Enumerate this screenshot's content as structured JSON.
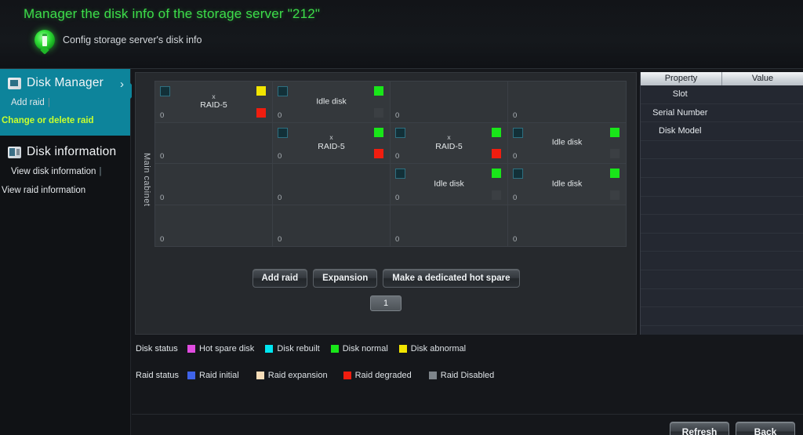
{
  "header": {
    "title": "Manager the disk info of the storage server \"212\"",
    "subtitle": "Config storage server's disk info",
    "icon": "disk-info-badge-icon"
  },
  "sidebar": {
    "groups": [
      {
        "title": "Disk Manager",
        "icon": "disk-manager-icon",
        "chevron": "›",
        "active": true,
        "links": [
          {
            "label": "Add raid",
            "highlight": false
          },
          {
            "label": "Change or delete raid",
            "highlight": true
          }
        ],
        "separator": "|"
      },
      {
        "title": "Disk information",
        "icon": "disk-information-icon",
        "active": false,
        "links": [
          {
            "label": "View disk information",
            "highlight": false
          },
          {
            "label": "View raid information",
            "highlight": false
          }
        ],
        "separator": "|"
      }
    ]
  },
  "main": {
    "cabinet_label": "Main cabinet",
    "grid": {
      "columns": 4,
      "rows": 4,
      "cells": [
        {
          "slot": "0",
          "label": "RAID-5",
          "prefix": "x",
          "status_top": "#f2e500",
          "status_bottom": "#f01d0f",
          "occupied": true
        },
        {
          "slot": "0",
          "label": "Idle disk",
          "prefix": "",
          "status_top": "#19e619",
          "status_bottom": "#3b3f43",
          "occupied": true
        },
        {
          "slot": "0",
          "label": "",
          "prefix": "",
          "status_top": "",
          "status_bottom": "",
          "occupied": false
        },
        {
          "slot": "0",
          "label": "",
          "prefix": "",
          "status_top": "",
          "status_bottom": "",
          "occupied": false
        },
        {
          "slot": "0",
          "label": "",
          "prefix": "",
          "status_top": "",
          "status_bottom": "",
          "occupied": false
        },
        {
          "slot": "0",
          "label": "RAID-5",
          "prefix": "x",
          "status_top": "#19e619",
          "status_bottom": "#f01d0f",
          "occupied": true
        },
        {
          "slot": "0",
          "label": "RAID-5",
          "prefix": "x",
          "status_top": "#19e619",
          "status_bottom": "#f01d0f",
          "occupied": true
        },
        {
          "slot": "0",
          "label": "Idle disk",
          "prefix": "",
          "status_top": "#19e619",
          "status_bottom": "#3b3f43",
          "occupied": true
        },
        {
          "slot": "0",
          "label": "",
          "prefix": "",
          "status_top": "",
          "status_bottom": "",
          "occupied": false
        },
        {
          "slot": "0",
          "label": "",
          "prefix": "",
          "status_top": "",
          "status_bottom": "",
          "occupied": false
        },
        {
          "slot": "0",
          "label": "Idle disk",
          "prefix": "",
          "status_top": "#19e619",
          "status_bottom": "#3b3f43",
          "occupied": true
        },
        {
          "slot": "0",
          "label": "Idle disk",
          "prefix": "",
          "status_top": "#19e619",
          "status_bottom": "#3b3f43",
          "occupied": true
        },
        {
          "slot": "0",
          "label": "",
          "prefix": "",
          "status_top": "",
          "status_bottom": "",
          "occupied": false
        },
        {
          "slot": "0",
          "label": "",
          "prefix": "",
          "status_top": "",
          "status_bottom": "",
          "occupied": false
        },
        {
          "slot": "0",
          "label": "",
          "prefix": "",
          "status_top": "",
          "status_bottom": "",
          "occupied": false
        },
        {
          "slot": "0",
          "label": "",
          "prefix": "",
          "status_top": "",
          "status_bottom": "",
          "occupied": false
        }
      ]
    },
    "actions": [
      {
        "label": "Add raid"
      },
      {
        "label": "Expansion"
      },
      {
        "label": "Make a dedicated hot spare"
      }
    ],
    "pagination": {
      "current": "1"
    }
  },
  "legend": {
    "disk_status_title": "Disk status",
    "disk_status": [
      {
        "label": "Hot spare disk",
        "color": "#e04ce0"
      },
      {
        "label": "Disk rebuilt",
        "color": "#00e5f0"
      },
      {
        "label": "Disk normal",
        "color": "#19e619"
      },
      {
        "label": "Disk abnormal",
        "color": "#f2e500"
      }
    ],
    "raid_status_title": "Raid status",
    "raid_status": [
      {
        "label": "Raid initial",
        "color": "#3f63e8"
      },
      {
        "label": "Raid expansion",
        "color": "#f7ddb8"
      },
      {
        "label": "Raid degraded",
        "color": "#f01d0f"
      },
      {
        "label": "Raid Disabled",
        "color": "#7e858b"
      }
    ]
  },
  "property_table": {
    "headers": [
      "Property",
      "Value"
    ],
    "rows": [
      {
        "property": "Slot",
        "value": ""
      },
      {
        "property": "Serial Number",
        "value": ""
      },
      {
        "property": "Disk Model",
        "value": ""
      },
      {
        "property": "",
        "value": ""
      },
      {
        "property": "",
        "value": ""
      },
      {
        "property": "",
        "value": ""
      },
      {
        "property": "",
        "value": ""
      },
      {
        "property": "",
        "value": ""
      },
      {
        "property": "",
        "value": ""
      },
      {
        "property": "",
        "value": ""
      },
      {
        "property": "",
        "value": ""
      },
      {
        "property": "",
        "value": ""
      },
      {
        "property": "",
        "value": ""
      }
    ]
  },
  "footer": {
    "refresh_label": "Refresh",
    "back_label": "Back"
  }
}
